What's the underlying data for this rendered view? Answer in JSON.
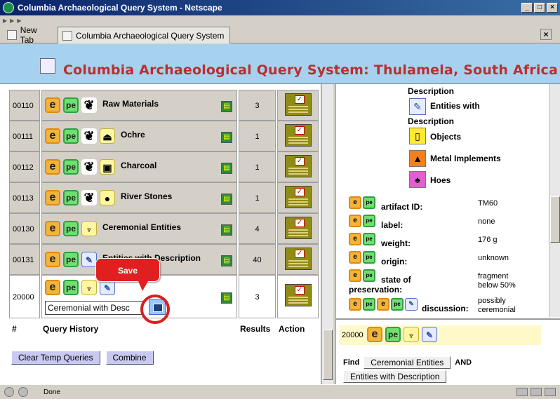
{
  "window": {
    "title": "Columbia Archaeological Query System - Netscape"
  },
  "tabs": [
    {
      "label": "New Tab"
    },
    {
      "label": "Columbia Archaeological Query System"
    }
  ],
  "header": {
    "title": "Columbia Archaeological Query System: Thulamela, South Africa"
  },
  "queries": [
    {
      "id": "00110",
      "label": "Raw Materials",
      "results": "3"
    },
    {
      "id": "00111",
      "label": "Ochre",
      "results": "1"
    },
    {
      "id": "00112",
      "label": "Charcoal",
      "results": "1"
    },
    {
      "id": "00113",
      "label": "River Stones",
      "results": "1"
    },
    {
      "id": "00130",
      "label": "Ceremonial Entities",
      "results": "4"
    },
    {
      "id": "00131",
      "label": "Entities with Description",
      "results": "40"
    },
    {
      "id": "20000",
      "name_value": "Ceremonial with Desc",
      "results": "3"
    }
  ],
  "table_headers": {
    "num": "#",
    "query": "Query History",
    "results": "Results",
    "action": "Action"
  },
  "tooltip": {
    "label": "Save"
  },
  "buttons": {
    "clear": "Clear Temp Queries",
    "combine": "Combine"
  },
  "right": {
    "tree": [
      {
        "label": "Description"
      },
      {
        "label": "Entities with"
      },
      {
        "label": "Description"
      },
      {
        "label": "Objects"
      },
      {
        "label": "Metal Implements"
      },
      {
        "label": "Hoes"
      }
    ],
    "details": [
      {
        "label": "artifact ID:",
        "value": "TM60"
      },
      {
        "label": "label:",
        "value": "none"
      },
      {
        "label": "weight:",
        "value": "176 g"
      },
      {
        "label": "origin:",
        "value": "unknown"
      },
      {
        "label": "state of",
        "label2": "preservation:",
        "value": "fragment",
        "value2": "below 50%"
      },
      {
        "label": "discussion:",
        "value": "possibly",
        "value2": "ceremonial"
      }
    ],
    "combo": {
      "id": "20000"
    },
    "find": {
      "label": "Find",
      "term1": "Ceremonial Entities",
      "op": "AND",
      "term2": "Entities with Description"
    }
  },
  "status": {
    "text": "Done"
  },
  "icon_glyphs": {
    "e": "e",
    "pe": "pe",
    "leaf": "❦",
    "pot": "⏏",
    "square": "▣",
    "stones": "●",
    "ceremonial": "♆",
    "book": "✎",
    "objects": "▯",
    "metal": "▲",
    "hoes": "♠"
  }
}
